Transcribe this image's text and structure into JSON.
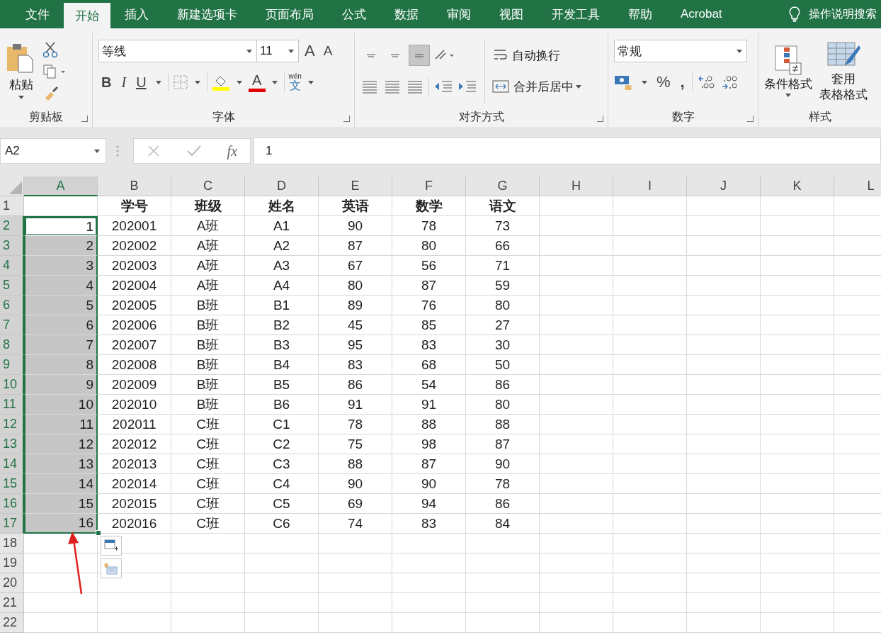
{
  "tabs": [
    {
      "label": "文件",
      "selected": false
    },
    {
      "label": "开始",
      "selected": true
    },
    {
      "label": "插入",
      "selected": false
    },
    {
      "label": "新建选项卡",
      "selected": false
    },
    {
      "label": "页面布局",
      "selected": false
    },
    {
      "label": "公式",
      "selected": false
    },
    {
      "label": "数据",
      "selected": false
    },
    {
      "label": "审阅",
      "selected": false
    },
    {
      "label": "视图",
      "selected": false
    },
    {
      "label": "开发工具",
      "selected": false
    },
    {
      "label": "帮助",
      "selected": false
    },
    {
      "label": "Acrobat",
      "selected": false
    }
  ],
  "tell_me": "操作说明搜索",
  "clipboard": {
    "paste": "粘贴",
    "label": "剪贴板"
  },
  "font": {
    "name": "等线",
    "size": "11",
    "grow": "A",
    "shrink": "A",
    "bold": "B",
    "italic": "I",
    "underline": "U",
    "font_color": "A",
    "phonetic_top": "wén",
    "phonetic_char": "文",
    "label": "字体"
  },
  "alignment": {
    "vertical": [
      {
        "selected": false
      },
      {
        "selected": false
      },
      {
        "selected": true
      }
    ],
    "wrap": "自动换行",
    "merge": "合并后居中",
    "label": "对齐方式"
  },
  "number": {
    "format": "常规",
    "percent": "%",
    "comma": ",",
    "label": "数字"
  },
  "styles": {
    "conditional": "条件格式",
    "table_format": [
      "套用",
      "表格格式"
    ],
    "label": "样式"
  },
  "formula_bar": {
    "name_box": "A2",
    "fx": "fx",
    "value": "1"
  },
  "columns": [
    {
      "label": "A",
      "selected": true
    },
    {
      "label": "B",
      "selected": false
    },
    {
      "label": "C",
      "selected": false
    },
    {
      "label": "D",
      "selected": false
    },
    {
      "label": "E",
      "selected": false
    },
    {
      "label": "F",
      "selected": false
    },
    {
      "label": "G",
      "selected": false
    },
    {
      "label": "H",
      "selected": false
    },
    {
      "label": "I",
      "selected": false
    },
    {
      "label": "J",
      "selected": false
    },
    {
      "label": "K",
      "selected": false
    },
    {
      "label": "L",
      "selected": false
    }
  ],
  "rows": [
    {
      "number": "1",
      "kind": "header",
      "selected": false,
      "cells": [
        "学号",
        "班级",
        "姓名",
        "英语",
        "数学",
        "语文"
      ]
    },
    {
      "number": "2",
      "kind": "data",
      "selected": true,
      "active": true,
      "a": "1",
      "cells": [
        "202001",
        "A班",
        "A1",
        "90",
        "78",
        "73"
      ]
    },
    {
      "number": "3",
      "kind": "data",
      "selected": true,
      "active": false,
      "a": "2",
      "cells": [
        "202002",
        "A班",
        "A2",
        "87",
        "80",
        "66"
      ]
    },
    {
      "number": "4",
      "kind": "data",
      "selected": true,
      "active": false,
      "a": "3",
      "cells": [
        "202003",
        "A班",
        "A3",
        "67",
        "56",
        "71"
      ]
    },
    {
      "number": "5",
      "kind": "data",
      "selected": true,
      "active": false,
      "a": "4",
      "cells": [
        "202004",
        "A班",
        "A4",
        "80",
        "87",
        "59"
      ]
    },
    {
      "number": "6",
      "kind": "data",
      "selected": true,
      "active": false,
      "a": "5",
      "cells": [
        "202005",
        "B班",
        "B1",
        "89",
        "76",
        "80"
      ]
    },
    {
      "number": "7",
      "kind": "data",
      "selected": true,
      "active": false,
      "a": "6",
      "cells": [
        "202006",
        "B班",
        "B2",
        "45",
        "85",
        "27"
      ]
    },
    {
      "number": "8",
      "kind": "data",
      "selected": true,
      "active": false,
      "a": "7",
      "cells": [
        "202007",
        "B班",
        "B3",
        "95",
        "83",
        "30"
      ]
    },
    {
      "number": "9",
      "kind": "data",
      "selected": true,
      "active": false,
      "a": "8",
      "cells": [
        "202008",
        "B班",
        "B4",
        "83",
        "68",
        "50"
      ]
    },
    {
      "number": "10",
      "kind": "data",
      "selected": true,
      "active": false,
      "a": "9",
      "cells": [
        "202009",
        "B班",
        "B5",
        "86",
        "54",
        "86"
      ]
    },
    {
      "number": "11",
      "kind": "data",
      "selected": true,
      "active": false,
      "a": "10",
      "cells": [
        "202010",
        "B班",
        "B6",
        "91",
        "91",
        "80"
      ]
    },
    {
      "number": "12",
      "kind": "data",
      "selected": true,
      "active": false,
      "a": "11",
      "cells": [
        "202011",
        "C班",
        "C1",
        "78",
        "88",
        "88"
      ]
    },
    {
      "number": "13",
      "kind": "data",
      "selected": true,
      "active": false,
      "a": "12",
      "cells": [
        "202012",
        "C班",
        "C2",
        "75",
        "98",
        "87"
      ]
    },
    {
      "number": "14",
      "kind": "data",
      "selected": true,
      "active": false,
      "a": "13",
      "cells": [
        "202013",
        "C班",
        "C3",
        "88",
        "87",
        "90"
      ]
    },
    {
      "number": "15",
      "kind": "data",
      "selected": true,
      "active": false,
      "a": "14",
      "cells": [
        "202014",
        "C班",
        "C4",
        "90",
        "90",
        "78"
      ]
    },
    {
      "number": "16",
      "kind": "data",
      "selected": true,
      "active": false,
      "a": "15",
      "cells": [
        "202015",
        "C班",
        "C5",
        "69",
        "94",
        "86"
      ]
    },
    {
      "number": "17",
      "kind": "data",
      "selected": true,
      "active": false,
      "a": "16",
      "cells": [
        "202016",
        "C班",
        "C6",
        "74",
        "83",
        "84"
      ]
    },
    {
      "number": "18",
      "kind": "blank",
      "selected": false
    },
    {
      "number": "19",
      "kind": "blank",
      "selected": false
    },
    {
      "number": "20",
      "kind": "blank",
      "selected": false
    },
    {
      "number": "21",
      "kind": "blank",
      "selected": false
    },
    {
      "number": "22",
      "kind": "blank",
      "selected": false
    }
  ]
}
